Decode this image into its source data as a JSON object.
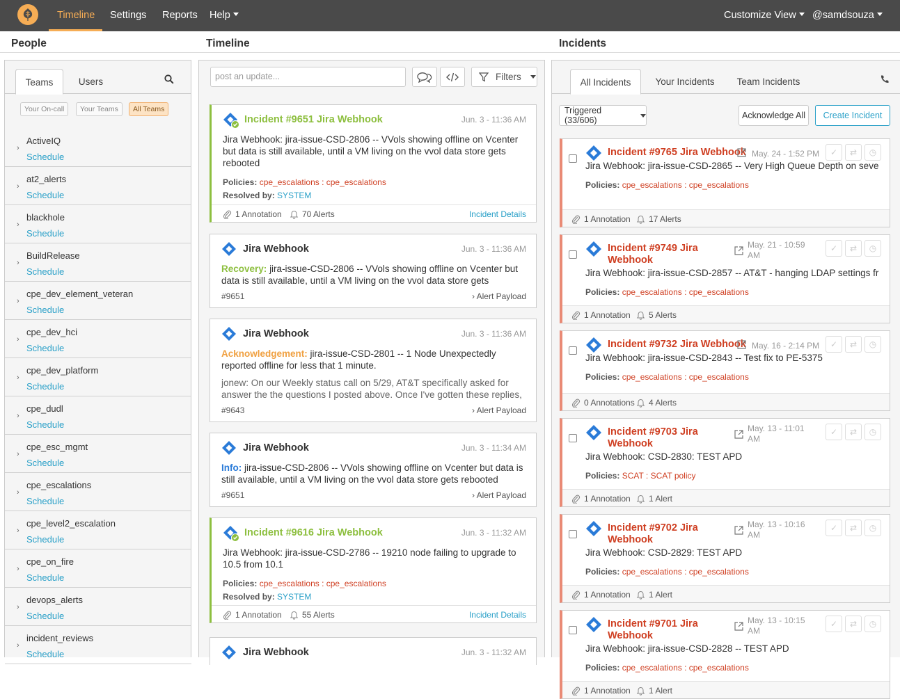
{
  "nav": {
    "items": [
      "Timeline",
      "Settings",
      "Reports",
      "Help"
    ],
    "customize": "Customize View",
    "user": "@samdsouza"
  },
  "columns": {
    "people": "People",
    "timeline": "Timeline",
    "incidents": "Incidents"
  },
  "people": {
    "tabs": [
      "Teams",
      "Users"
    ],
    "filters": [
      "Your On-call",
      "Your Teams",
      "All Teams"
    ],
    "schedule_label": "Schedule",
    "teams": [
      "ActiveIQ",
      "at2_alerts",
      "blackhole",
      "BuildRelease",
      "cpe_dev_element_veteran",
      "cpe_dev_hci",
      "cpe_dev_platform",
      "cpe_dudl",
      "cpe_esc_mgmt",
      "cpe_escalations",
      "cpe_level2_escalation",
      "cpe_on_fire",
      "devops_alerts",
      "incident_reviews"
    ]
  },
  "timeline": {
    "post_placeholder": "post an update...",
    "filters_label": "Filters",
    "cards": [
      {
        "title": "Incident #9651 Jira Webhook",
        "time": "Jun. 3 - 11:36 AM",
        "body": "Jira Webhook: jira-issue-CSD-2806 -- VVols showing offline on Vcenter but data is still available, until a VM living on the vvol data store gets rebooted",
        "policies_label": "Policies:",
        "policies": "cpe_escalations : cpe_escalations",
        "resolved_label": "Resolved by:",
        "resolved_by": "SYSTEM",
        "annotations": "1 Annotation",
        "alerts": "70 Alerts",
        "details": "Incident Details"
      },
      {
        "title": "Jira Webhook",
        "time": "Jun. 3 - 11:36 AM",
        "label": "Recovery:",
        "body": "jira-issue-CSD-2806 -- VVols showing offline on Vcenter but data is still available, until a VM living on the vvol data store gets",
        "ref": "#9651",
        "payload": "Alert Payload"
      },
      {
        "title": "Jira Webhook",
        "time": "Jun. 3 - 11:36 AM",
        "label": "Acknowledgement:",
        "body": "jira-issue-CSD-2801 -- 1 Node Unexpectedly reported offline for less that 1 minute.",
        "note": "jonew: On our Weekly status call on 5/29, AT&T specifically asked for answer the the questions I posted above. Once I've gotten these replies,",
        "ref": "#9643",
        "payload": "Alert Payload"
      },
      {
        "title": "Jira Webhook",
        "time": "Jun. 3 - 11:34 AM",
        "label": "Info:",
        "body": "jira-issue-CSD-2806 -- VVols showing offline on Vcenter but data is still available, until a VM living on the vvol data store gets rebooted",
        "ref": "#9651",
        "payload": "Alert Payload"
      },
      {
        "title": "Incident #9616 Jira Webhook",
        "time": "Jun. 3 - 11:32 AM",
        "body": "Jira Webhook: jira-issue-CSD-2786 -- 19210 node failing to upgrade to 10.5 from 10.1",
        "policies_label": "Policies:",
        "policies": "cpe_escalations : cpe_escalations",
        "resolved_label": "Resolved by:",
        "resolved_by": "SYSTEM",
        "annotations": "1 Annotation",
        "alerts": "55 Alerts",
        "details": "Incident Details"
      },
      {
        "title": "Jira Webhook",
        "time": "Jun. 3 - 11:32 AM"
      }
    ]
  },
  "incidents": {
    "tabs": [
      "All Incidents",
      "Your Incidents",
      "Team Incidents"
    ],
    "status_select": "Triggered (33/606)",
    "ack_all": "Acknowledge All",
    "create": "Create Incident",
    "policies_label": "Policies:",
    "items": [
      {
        "title1": "Incident #9765 Jira Webhook",
        "title2": "",
        "time1": "May. 24 - 1:52 PM",
        "time2": "",
        "desc": "Jira Webhook: jira-issue-CSD-2865 -- Very High Queue Depth on seve",
        "policies": "cpe_escalations : cpe_escalations",
        "annotations": "1 Annotation",
        "alerts": "17 Alerts"
      },
      {
        "title1": "Incident #9749 Jira",
        "title2": "Webhook",
        "time1": "May. 21 - 10:59",
        "time2": "AM",
        "desc": "Jira Webhook: jira-issue-CSD-2857 -- AT&T - hanging LDAP settings fr",
        "policies": "cpe_escalations : cpe_escalations",
        "annotations": "1 Annotation",
        "alerts": "5 Alerts"
      },
      {
        "title1": "Incident #9732 Jira Webhook",
        "title2": "",
        "time1": "May. 16 - 2:14 PM",
        "time2": "",
        "desc": "Jira Webhook: jira-issue-CSD-2843 -- Test fix to PE-5375",
        "policies": "cpe_escalations : cpe_escalations",
        "annotations": "0 Annotations",
        "alerts": "4 Alerts"
      },
      {
        "title1": "Incident #9703 Jira",
        "title2": "Webhook",
        "time1": "May. 13 - 11:01",
        "time2": "AM",
        "desc": "Jira Webhook: CSD-2830: TEST APD",
        "policies": "SCAT : SCAT policy",
        "annotations": "1 Annotation",
        "alerts": "1 Alert"
      },
      {
        "title1": "Incident #9702 Jira",
        "title2": "Webhook",
        "time1": "May. 13 - 10:16",
        "time2": "AM",
        "desc": "Jira Webhook: CSD-2829: TEST APD",
        "policies": "cpe_escalations : cpe_escalations",
        "annotations": "1 Annotation",
        "alerts": "1 Alert"
      },
      {
        "title1": "Incident #9701 Jira",
        "title2": "Webhook",
        "time1": "May. 13 - 10:15",
        "time2": "AM",
        "desc": "Jira Webhook: jira-issue-CSD-2828 -- TEST APD",
        "policies": "cpe_escalations : cpe_escalations",
        "annotations": "1 Annotation",
        "alerts": "1 Alert"
      }
    ]
  },
  "colors": {
    "accent": "#f6ad55",
    "link": "#2aa0c8",
    "danger": "#cf3f22",
    "resolved": "#8dbf3f",
    "navbar": "#4a4a4a"
  }
}
